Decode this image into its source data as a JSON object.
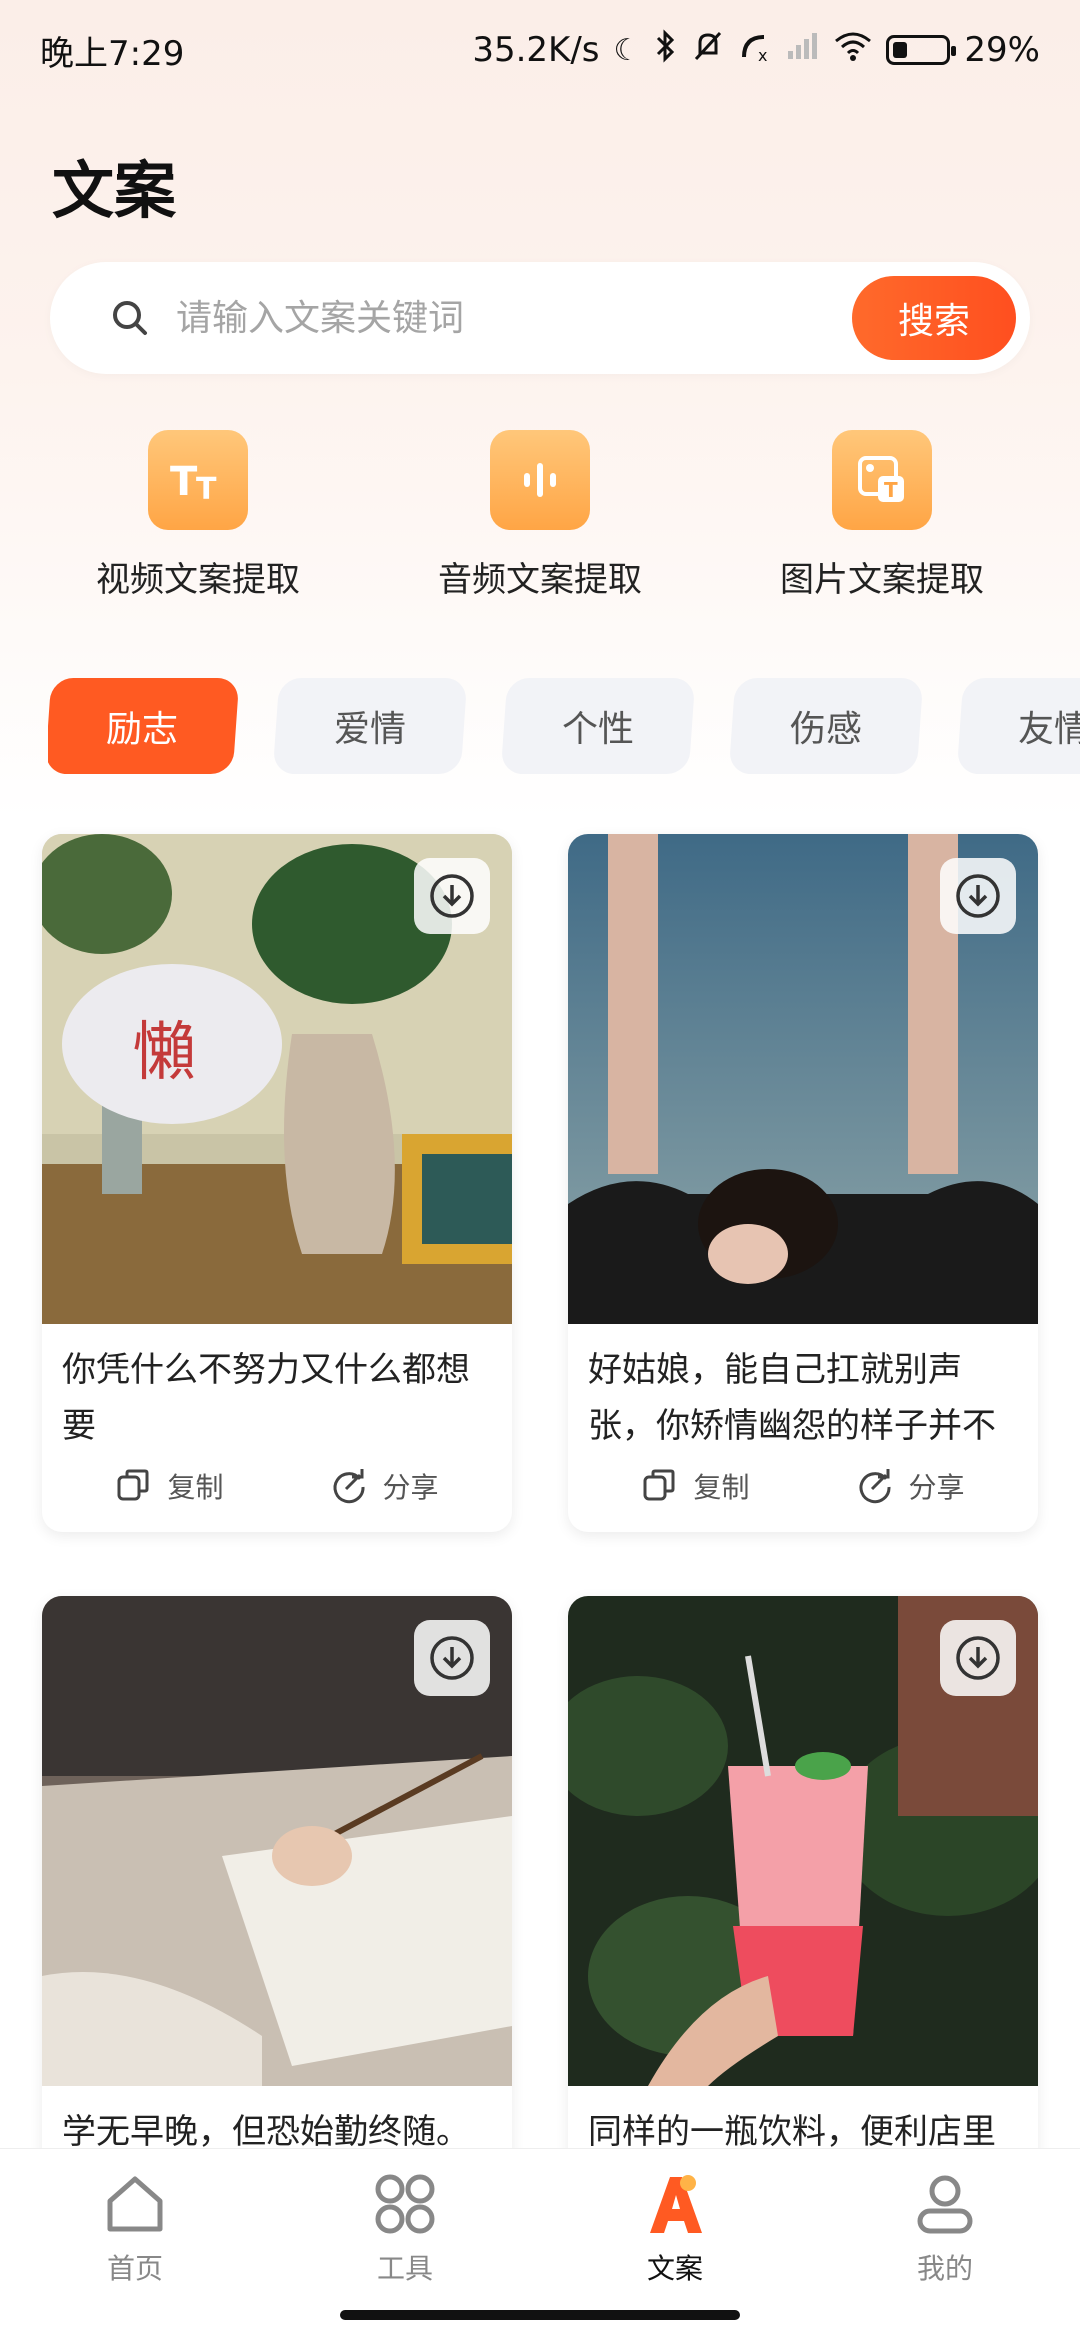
{
  "status": {
    "time": "晚上7:29",
    "speed": "35.2K/s",
    "battery_text": "29%",
    "battery_level": 0.29,
    "icons": [
      "moon-icon",
      "bluetooth-icon",
      "mute-bell-icon",
      "call-missed-icon",
      "signal-icon",
      "wifi-icon",
      "battery-icon"
    ]
  },
  "page": {
    "title": "文案"
  },
  "search": {
    "placeholder": "请输入文案关键词",
    "button": "搜索"
  },
  "tools": [
    {
      "label": "视频文案提取",
      "icon": "text-tt-icon"
    },
    {
      "label": "音频文案提取",
      "icon": "audio-bars-icon"
    },
    {
      "label": "图片文案提取",
      "icon": "image-text-icon"
    }
  ],
  "categories": [
    {
      "label": "励志",
      "active": true
    },
    {
      "label": "爱情",
      "active": false
    },
    {
      "label": "个性",
      "active": false
    },
    {
      "label": "伤感",
      "active": false
    },
    {
      "label": "友情",
      "active": false
    }
  ],
  "cards": [
    {
      "text": "你凭什么不努力又什么都想要",
      "copy": "复制",
      "share": "分享",
      "image": "room-with-fan-and-vases"
    },
    {
      "text": "好姑娘，能自己扛就别声张，你矫情幽怨的样子并不漂…",
      "copy": "复制",
      "share": "分享",
      "image": "woman-raising-arms-sky"
    },
    {
      "text": "学无早晚，但恐始勤终随。",
      "copy": "",
      "share": "",
      "image": "hand-writing-calligraphy"
    },
    {
      "text": "同样的一瓶饮料，便利店里",
      "copy": "",
      "share": "",
      "image": "hand-holding-pink-drink"
    }
  ],
  "nav": [
    {
      "label": "首页",
      "icon": "home-icon",
      "active": false
    },
    {
      "label": "工具",
      "icon": "grid-icon",
      "active": false
    },
    {
      "label": "文案",
      "icon": "letter-a-icon",
      "active": true
    },
    {
      "label": "我的",
      "icon": "user-icon",
      "active": false
    }
  ],
  "colors": {
    "accent": "#ff5a22",
    "tool_icon": "#ffb05a",
    "chip_bg": "#f2f3f7"
  }
}
